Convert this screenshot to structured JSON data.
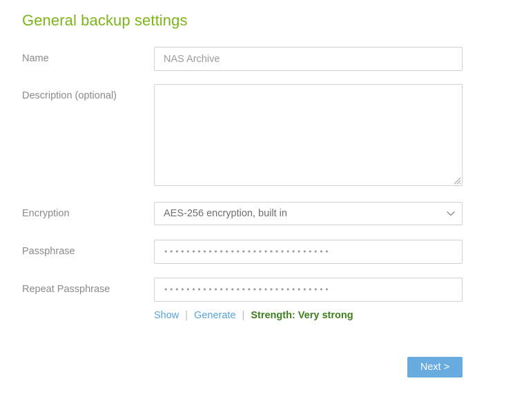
{
  "page": {
    "title": "General backup settings",
    "title_color": "#7cb518",
    "background": "#ffffff"
  },
  "form": {
    "fields": [
      {
        "key": "name",
        "label": "Name",
        "type": "text",
        "value": "",
        "placeholder": "NAS Archive"
      },
      {
        "key": "description",
        "label": "Description (optional)",
        "type": "textarea",
        "value": "",
        "placeholder": ""
      },
      {
        "key": "encryption",
        "label": "Encryption",
        "type": "select",
        "value": "AES-256 encryption, built in",
        "options": [
          "AES-256 encryption, built in"
        ],
        "arrow_icon": "chevron-down-icon"
      },
      {
        "key": "passphrase",
        "label": "Passphrase",
        "type": "password",
        "masked_value": "••••••••••••••••••••••••••••••"
      },
      {
        "key": "repeat_passphrase",
        "label": "Repeat Passphrase",
        "type": "password",
        "masked_value": "••••••••••••••••••••••••••••••"
      }
    ]
  },
  "passphrase_helpers": {
    "show_label": "Show",
    "separator": "|",
    "generate_label": "Generate",
    "strength_label": "Strength: Very strong",
    "link_color": "#56a3db",
    "strength_color": "#3d7e1f"
  },
  "footer": {
    "next_label": "Next >",
    "next_color": "#68acdf"
  }
}
